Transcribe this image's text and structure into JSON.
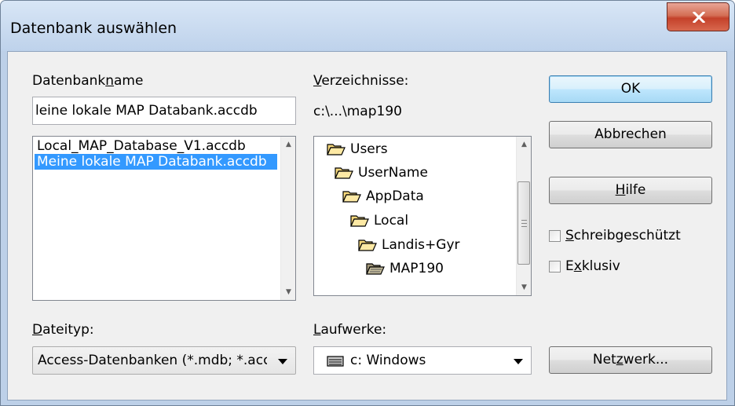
{
  "window": {
    "title": "Datenbank auswählen",
    "close_icon": "close-icon"
  },
  "database_name": {
    "label_pre": "Datenbank",
    "label_u": "n",
    "label_post": "ame",
    "input_value": "leine lokale MAP Databank.accdb",
    "files": [
      "Local_MAP_Database_V1.accdb",
      "Meine lokale MAP Databank.accdb"
    ],
    "selected_index": 1
  },
  "directories": {
    "label_u": "V",
    "label_post": "erzeichnisse:",
    "current_path": "c:\\...\\map190",
    "tree": [
      {
        "name": "Users",
        "icon": "open-folder-icon"
      },
      {
        "name": "UserName",
        "icon": "open-folder-icon"
      },
      {
        "name": "AppData",
        "icon": "open-folder-icon"
      },
      {
        "name": "Local",
        "icon": "open-folder-icon"
      },
      {
        "name": "Landis+Gyr",
        "icon": "open-folder-icon"
      },
      {
        "name": "MAP190",
        "icon": "open-folder-selected-icon"
      }
    ]
  },
  "file_type": {
    "label_u": "D",
    "label_post": "ateityp:",
    "value": "Access-Datenbanken (*.mdb; *.accdb)"
  },
  "drives": {
    "label_u": "L",
    "label_post": "aufwerke:",
    "value": "c: Windows",
    "icon": "drive-icon"
  },
  "buttons": {
    "ok": "OK",
    "cancel": "Abbrechen",
    "help_u": "H",
    "help_post": "ilfe",
    "network_pre": "Net",
    "network_u": "z",
    "network_post": "werk..."
  },
  "options": {
    "readonly_u": "S",
    "readonly_post": "chreibgeschützt",
    "readonly_checked": false,
    "exclusive_pre": "E",
    "exclusive_u": "x",
    "exclusive_post": "klusiv",
    "exclusive_checked": false
  },
  "colors": {
    "selection": "#3399ff",
    "close_button": "#c4412a",
    "default_button_border": "#3c7fb1"
  }
}
